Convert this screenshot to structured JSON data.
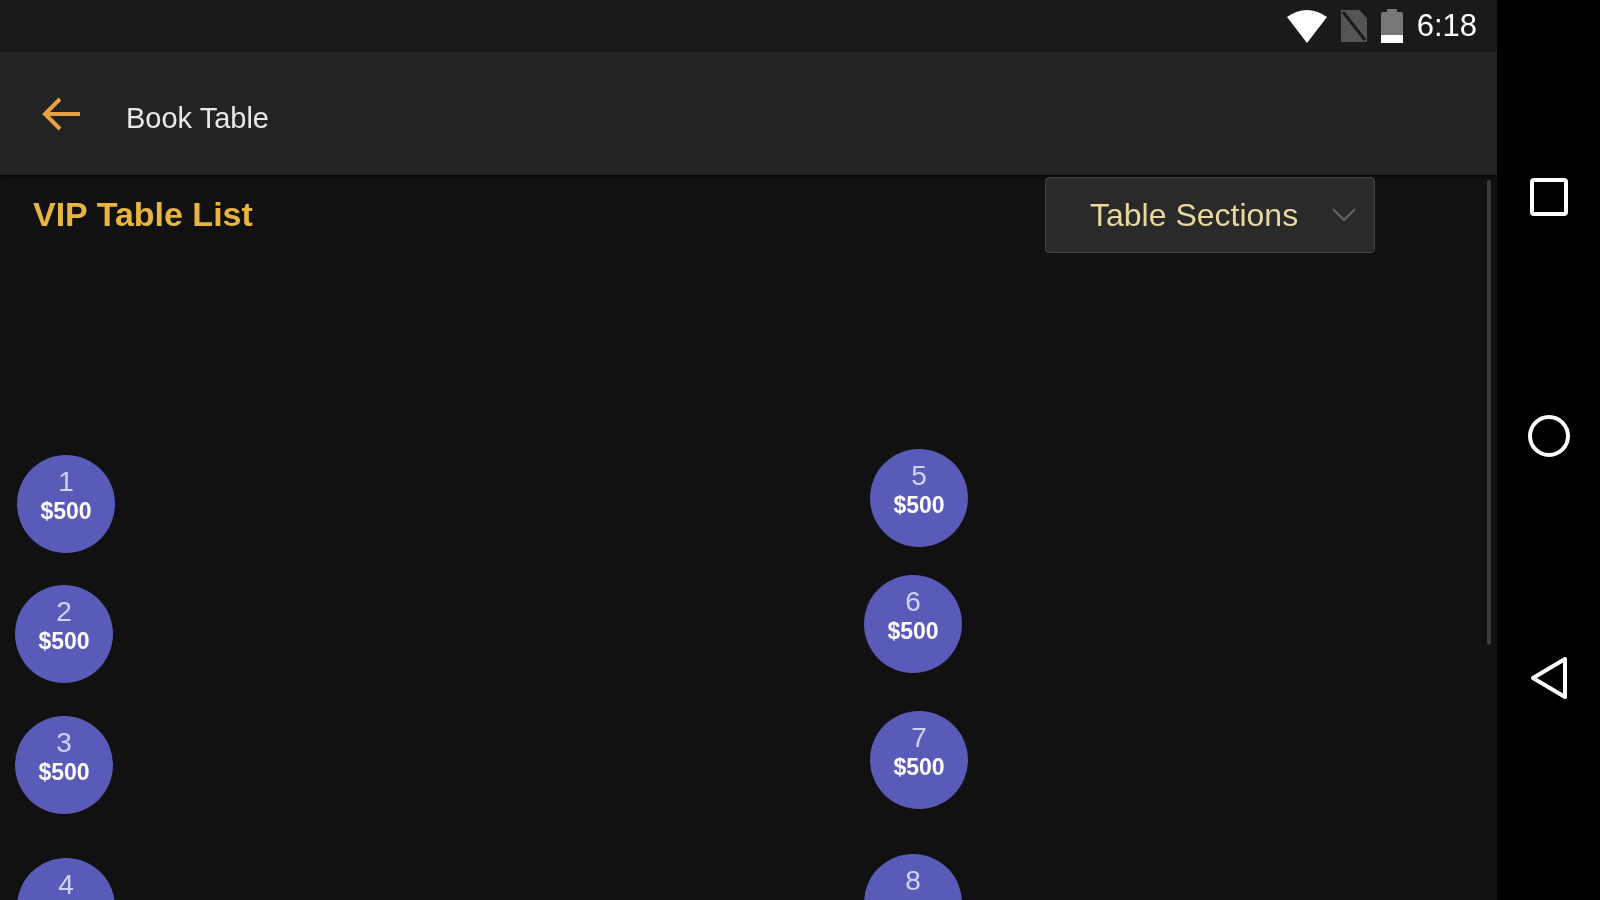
{
  "status_bar": {
    "time": "6:18"
  },
  "app_bar": {
    "title": "Book Table"
  },
  "heading": "VIP Table List",
  "section_dropdown": {
    "label": "Table Sections"
  },
  "tables": [
    {
      "number": "1",
      "price": "$500"
    },
    {
      "number": "2",
      "price": "$500"
    },
    {
      "number": "3",
      "price": "$500"
    },
    {
      "number": "4"
    },
    {
      "number": "5",
      "price": "$500"
    },
    {
      "number": "6",
      "price": "$500"
    },
    {
      "number": "7",
      "price": "$500"
    },
    {
      "number": "8"
    }
  ]
}
